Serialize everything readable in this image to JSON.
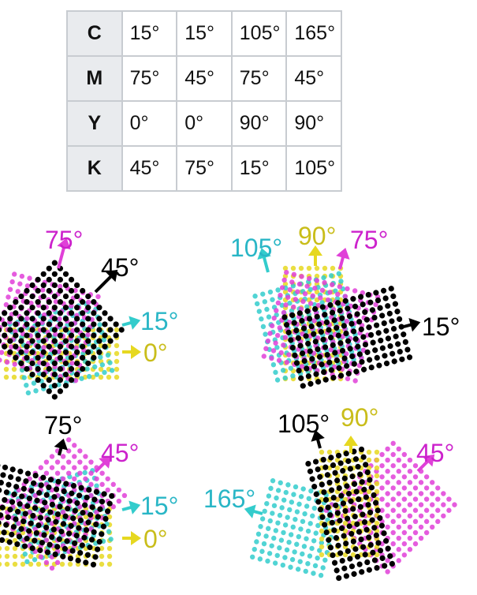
{
  "table": {
    "rows": [
      {
        "ink": "C",
        "cells": [
          "15°",
          "15°",
          "105°",
          "165°"
        ]
      },
      {
        "ink": "M",
        "cells": [
          "75°",
          "45°",
          "75°",
          "45°"
        ]
      },
      {
        "ink": "Y",
        "cells": [
          "0°",
          "0°",
          "90°",
          "90°"
        ]
      },
      {
        "ink": "K",
        "cells": [
          "45°",
          "75°",
          "15°",
          "105°"
        ]
      }
    ]
  },
  "colors": {
    "C": "#33cccc",
    "M": "#e040d8",
    "Y": "#e6d820",
    "K": "#000000",
    "Clabel": "#29b6c6",
    "Mlabel": "#cc22cc",
    "Ylabel": "#c9bd1a"
  },
  "panels": [
    {
      "name": "panel-top-left",
      "screens": [
        {
          "ink": "M",
          "angle": 75,
          "label": "75°"
        },
        {
          "ink": "K",
          "angle": 45,
          "label": "45°"
        },
        {
          "ink": "C",
          "angle": 15,
          "label": "15°"
        },
        {
          "ink": "Y",
          "angle": 0,
          "label": "0°"
        }
      ]
    },
    {
      "name": "panel-top-right",
      "screens": [
        {
          "ink": "C",
          "angle": 105,
          "label": "105°"
        },
        {
          "ink": "Y",
          "angle": 90,
          "label": "90°"
        },
        {
          "ink": "M",
          "angle": 75,
          "label": "75°"
        },
        {
          "ink": "K",
          "angle": 15,
          "label": "15°"
        }
      ]
    },
    {
      "name": "panel-bottom-left",
      "screens": [
        {
          "ink": "K",
          "angle": 75,
          "label": "75°"
        },
        {
          "ink": "M",
          "angle": 45,
          "label": "45°"
        },
        {
          "ink": "C",
          "angle": 15,
          "label": "15°"
        },
        {
          "ink": "Y",
          "angle": 0,
          "label": "0°"
        }
      ]
    },
    {
      "name": "panel-bottom-right",
      "screens": [
        {
          "ink": "K",
          "angle": 105,
          "label": "105°"
        },
        {
          "ink": "Y",
          "angle": 90,
          "label": "90°"
        },
        {
          "ink": "M",
          "angle": 45,
          "label": "45°"
        },
        {
          "ink": "C",
          "angle": 165,
          "label": "165°"
        }
      ]
    }
  ]
}
